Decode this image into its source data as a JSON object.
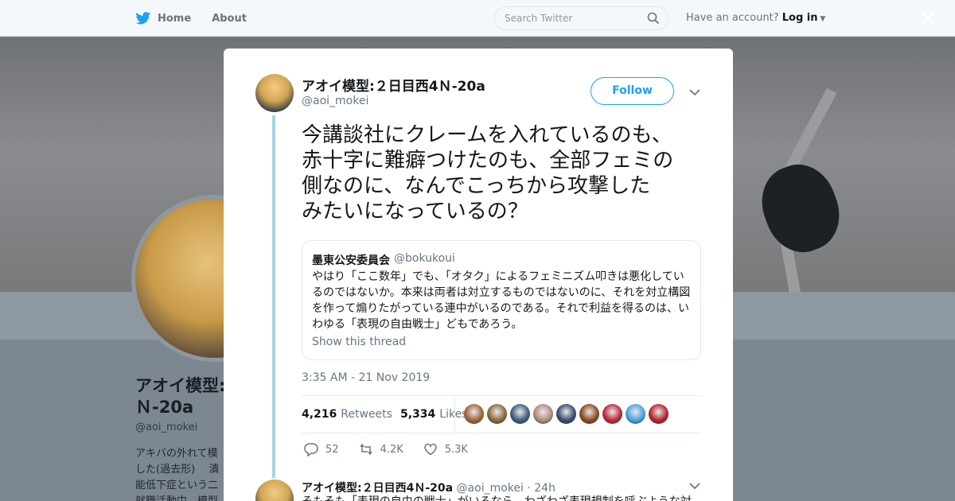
{
  "topbar": {
    "home_label": "Home",
    "about_label": "About",
    "search_placeholder": "Search Twitter",
    "have_account": "Have an account?",
    "login_label": "Log in"
  },
  "background_profile": {
    "name_line1": "アオイ模型:",
    "name_line2": "Ｎ-20a",
    "handle": "@aoi_mokei",
    "bio_lines": [
      "アキバの外れて模",
      "した(過去形)　 潰",
      "能低下症という二",
      "就職活動中。模型"
    ]
  },
  "tweet": {
    "author_name": "アオイ模型:２日目西4Ｎ-20a",
    "author_handle": "@aoi_mokei",
    "follow_label": "Follow",
    "text_lines": [
      "今講談社にクレームを入れているのも、",
      "赤十字に難癖つけたのも、全部フェミの",
      "側なのに、なんでこっちから攻撃した",
      "みたいになっているの？"
    ],
    "quote": {
      "name": "墨東公安委員会",
      "handle": "@bokukoui",
      "text_lines": [
        "やはり「ここ数年」でも、「オタク」によるフェミニズム叩きは悪化してい",
        "るのではないか。本来は両者は対立するものではないのに、それを対立構図",
        "を作って煽りたがっている連中がいるのである。それで利益を得るのは、い",
        "わゆる「表現の自由戦士」どもであろう。"
      ],
      "show_thread": "Show this thread"
    },
    "timestamp": "3:35 AM - 21 Nov 2019",
    "retweets_count": "4,216",
    "retweets_label": "Retweets",
    "likes_count": "5,334",
    "likes_label": "Likes",
    "likers": [
      "#a0643a",
      "#8a6a3a",
      "#3d5f7a",
      "#b08a80",
      "#3a4c6e",
      "#8c4a1e",
      "#c0283c",
      "#4aa3df",
      "#b8222a"
    ],
    "actions": {
      "reply_count": "52",
      "retweet_count": "4.2K",
      "like_count": "5.3K"
    }
  },
  "reply": {
    "author_name": "アオイ模型:２日目西4Ｎ-20a",
    "author_handle": "@aoi_mokei",
    "separator": "·",
    "time": "24h",
    "text": "そもそも「表現の自由の戦士」がいるなら、わざわざ表現規制を呼ぶような対"
  },
  "colors": {
    "accent": "#1da1f2",
    "thread_line": "#a7d3e3",
    "secondary_text": "#657786"
  }
}
